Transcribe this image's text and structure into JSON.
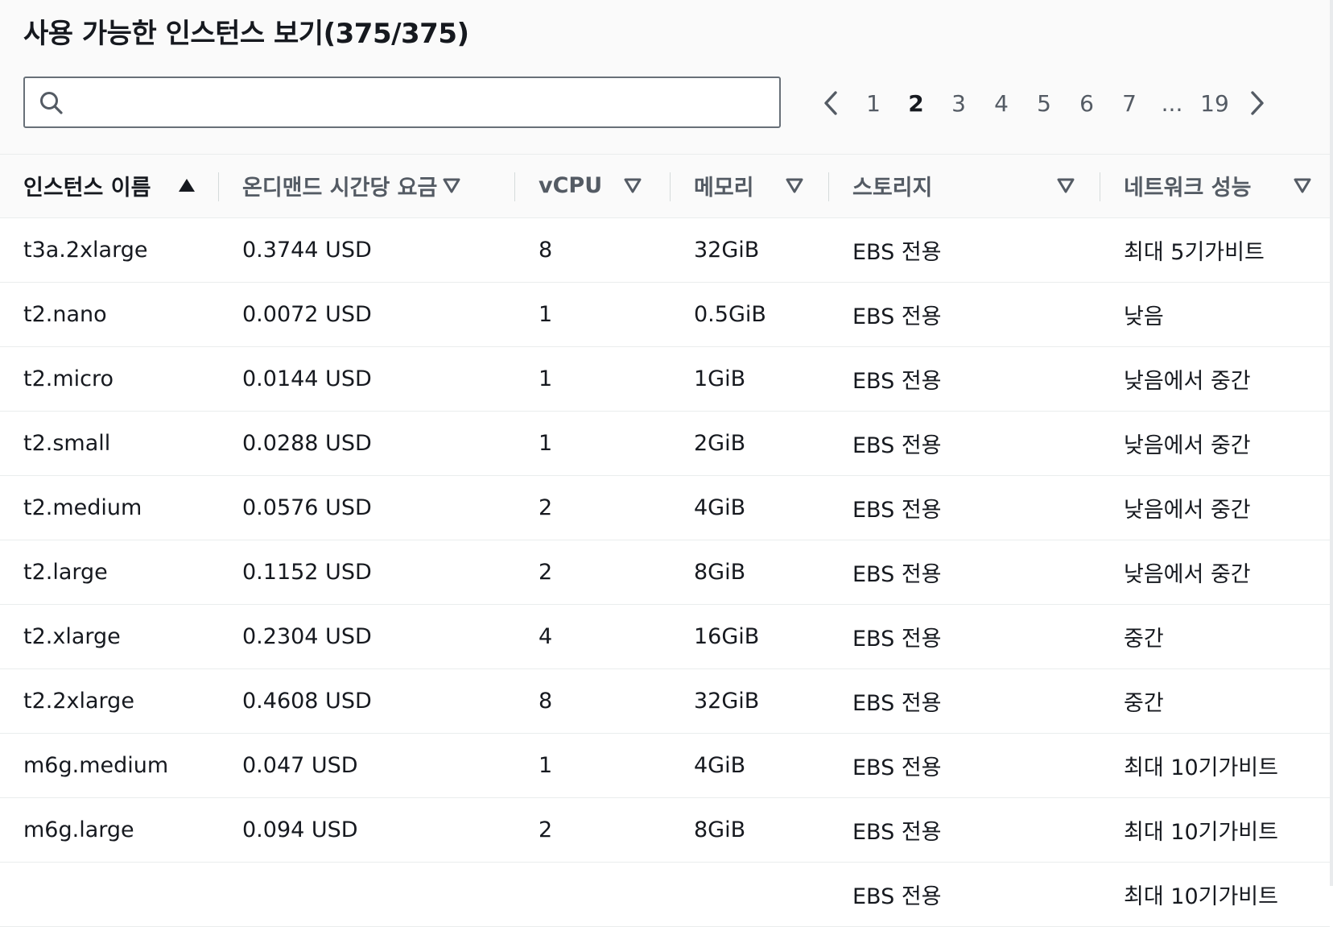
{
  "header": {
    "title": "사용 가능한 인스턴스 보기(375/375)",
    "search_value": "",
    "search_placeholder": ""
  },
  "pagination": {
    "pages": [
      "1",
      "2",
      "3",
      "4",
      "5",
      "6",
      "7",
      "...",
      "19"
    ],
    "current": "2"
  },
  "table": {
    "columns": [
      {
        "label": "인스턴스 이름",
        "sort": "ascending"
      },
      {
        "label": "온디맨드 시간당 요금",
        "sort": "none"
      },
      {
        "label": "vCPU",
        "sort": "none"
      },
      {
        "label": "메모리",
        "sort": "none"
      },
      {
        "label": "스토리지",
        "sort": "none"
      },
      {
        "label": "네트워크 성능",
        "sort": "none"
      }
    ],
    "rows": [
      [
        "t3a.2xlarge",
        "0.3744 USD",
        "8",
        "32GiB",
        "EBS 전용",
        "최대 5기가비트"
      ],
      [
        "t2.nano",
        "0.0072 USD",
        "1",
        "0.5GiB",
        "EBS 전용",
        "낮음"
      ],
      [
        "t2.micro",
        "0.0144 USD",
        "1",
        "1GiB",
        "EBS 전용",
        "낮음에서 중간"
      ],
      [
        "t2.small",
        "0.0288 USD",
        "1",
        "2GiB",
        "EBS 전용",
        "낮음에서 중간"
      ],
      [
        "t2.medium",
        "0.0576 USD",
        "2",
        "4GiB",
        "EBS 전용",
        "낮음에서 중간"
      ],
      [
        "t2.large",
        "0.1152 USD",
        "2",
        "8GiB",
        "EBS 전용",
        "낮음에서 중간"
      ],
      [
        "t2.xlarge",
        "0.2304 USD",
        "4",
        "16GiB",
        "EBS 전용",
        "중간"
      ],
      [
        "t2.2xlarge",
        "0.4608 USD",
        "8",
        "32GiB",
        "EBS 전용",
        "중간"
      ],
      [
        "m6g.medium",
        "0.047 USD",
        "1",
        "4GiB",
        "EBS 전용",
        "최대 10기가비트"
      ],
      [
        "m6g.large",
        "0.094 USD",
        "2",
        "8GiB",
        "EBS 전용",
        "최대 10기가비트"
      ],
      [
        "",
        "",
        "",
        "",
        "EBS 전용",
        "최대 10기가비트"
      ]
    ]
  },
  "colors": {
    "text": "#16191f",
    "muted": "#545b64",
    "border": "#eaeded",
    "header_bg": "#fafafa"
  }
}
